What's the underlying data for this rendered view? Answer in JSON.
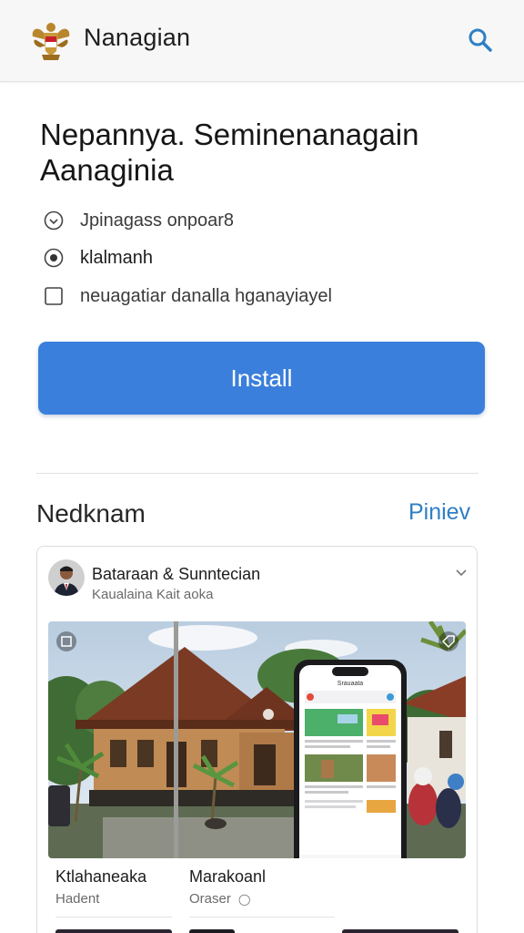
{
  "header": {
    "app_title": "Nanagian",
    "logo_icon": "garuda-emblem-icon",
    "search_icon": "search-icon",
    "accent": "#2f7fc4"
  },
  "main": {
    "headline": "Nepannya. Seminenanagain Aanaginia",
    "options": [
      {
        "label": "Jpinagass onpoar8",
        "icon": "clock-icon"
      },
      {
        "label": "klalmanh",
        "icon": "radio-icon"
      },
      {
        "label": "neuagatiar danalla hganayiayel",
        "icon": "checkbox-icon"
      }
    ],
    "install_label": "Install",
    "install_color": "#3a7fdb"
  },
  "section": {
    "title": "Nedknam",
    "link": "Piniev"
  },
  "card": {
    "title": "Bataraan & Sunntecian",
    "subtitle": "Kaualaina Kait aoka",
    "menu_icon": "chevron-down-icon",
    "media_icons": [
      "expand-icon",
      "tag-icon"
    ],
    "phone_header": "Srauaata",
    "caption_left": {
      "title": "Ktlahaneaka",
      "sub": "Hadent"
    },
    "caption_right": {
      "title": "Marakoanl",
      "sub": "Oraser"
    }
  }
}
